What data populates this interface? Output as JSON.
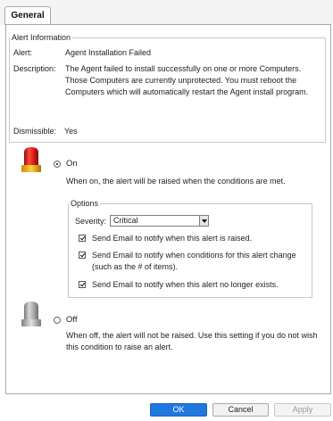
{
  "tabs": [
    {
      "label": "General",
      "active": true
    }
  ],
  "alert_info": {
    "legend": "Alert Information",
    "alert_label": "Alert:",
    "alert_value": "Agent Installation Failed",
    "description_label": "Description:",
    "description_value": "The Agent failed to install successfully on one or more Computers. Those Computers are currently unprotected. You must reboot the Computers which will automatically restart the Agent install program.",
    "dismissible_label": "Dismissible:",
    "dismissible_value": "Yes"
  },
  "on_section": {
    "icon": "red-siren-icon",
    "radio_label": "On",
    "selected": true,
    "description": "When on, the alert will be raised when the conditions are met."
  },
  "options": {
    "legend": "Options",
    "severity_label": "Severity:",
    "severity_value": "Critical",
    "checkboxes": [
      {
        "label": "Send Email to notify when this alert is raised.",
        "checked": true
      },
      {
        "label": "Send Email to notify when conditions for this alert change (such as the # of items).",
        "checked": true
      },
      {
        "label": "Send Email to notify when this alert no longer exists.",
        "checked": true
      }
    ]
  },
  "off_section": {
    "icon": "gray-siren-icon",
    "radio_label": "Off",
    "selected": false,
    "description": "When off, the alert will not be raised. Use this setting if you do not wish this condition to raise an alert."
  },
  "footer": {
    "ok_label": "OK",
    "cancel_label": "Cancel",
    "apply_label": "Apply"
  },
  "colors": {
    "accent": "#1f78e0",
    "siren_red": "#d91e1e",
    "siren_gray": "#9a9a9a"
  }
}
